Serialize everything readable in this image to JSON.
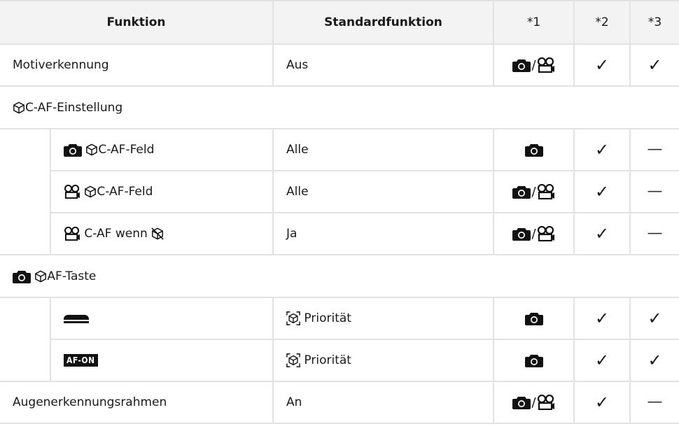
{
  "header": {
    "funktion": "Funktion",
    "standard": "Standardfunktion",
    "col1": "*1",
    "col2": "*2",
    "col3": "*3"
  },
  "rows": {
    "motiv": {
      "label": "Motiverkennung",
      "default": "Aus"
    },
    "caf_group": {
      "label": "C-AF-Einstellung"
    },
    "caf_feld_photo": {
      "label": "C-AF-Feld",
      "default": "Alle"
    },
    "caf_feld_movie": {
      "label": "C-AF-Feld",
      "default": "Alle"
    },
    "caf_wenn": {
      "label": "C-AF wenn",
      "default": "Ja"
    },
    "af_taste_group": {
      "label": "AF-Taste"
    },
    "shutter": {
      "default": "Priorität"
    },
    "afon": {
      "badge": "AF-ON",
      "default": "Priorität"
    },
    "augen": {
      "label": "Augenerkennungsrahmen",
      "default": "An"
    }
  },
  "symbols": {
    "slash": "/",
    "check": "✓",
    "dash": "—"
  },
  "icons": [
    "camera-icon",
    "movie-icon",
    "subject-detect-icon",
    "shutter-button-icon",
    "subject-detect-off-icon",
    "subject-frame-icon"
  ]
}
